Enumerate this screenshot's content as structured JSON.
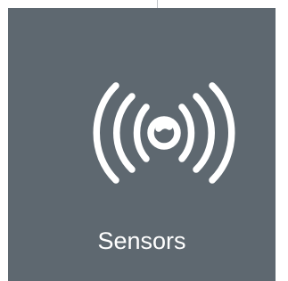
{
  "tile": {
    "label": "Sensors",
    "icon": "sensor-waves-icon",
    "background_color": "#5e6870",
    "foreground_color": "#ffffff"
  }
}
